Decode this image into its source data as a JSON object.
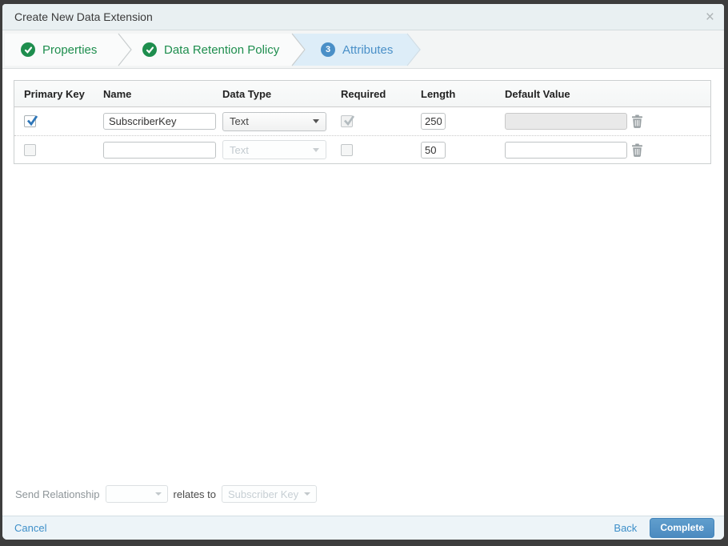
{
  "window": {
    "title": "Create New Data Extension",
    "close_icon": "×"
  },
  "wizard": {
    "steps": [
      {
        "label": "Properties",
        "status": "complete"
      },
      {
        "label": "Data Retention Policy",
        "status": "complete"
      },
      {
        "label": "Attributes",
        "status": "active",
        "number": "3"
      }
    ]
  },
  "table": {
    "headers": [
      "Primary Key",
      "Name",
      "Data Type",
      "Required",
      "Length",
      "Default Value"
    ],
    "rows": [
      {
        "primary_key": "checked",
        "name": "SubscriberKey",
        "data_type": "Text",
        "required": "checked-disabled",
        "length": "250",
        "default_value": "",
        "default_disabled": true
      },
      {
        "primary_key": "unchecked",
        "name": "",
        "data_type": "Text",
        "required": "unchecked",
        "length": "50",
        "default_value": "",
        "default_disabled": false
      }
    ]
  },
  "send_relationship": {
    "label": "Send Relationship",
    "source_value": "",
    "relates_to_label": "relates to",
    "target_value": "Subscriber Key"
  },
  "footer": {
    "cancel_label": "Cancel",
    "back_label": "Back",
    "complete_label": "Complete"
  },
  "colors": {
    "step_complete_green": "#1e8e4e",
    "step_active_blue": "#4a90c8",
    "step_active_bg": "#ddedf8",
    "link_blue": "#3d8fc9",
    "primary_button_blue": "#4b8ac0",
    "titlebar_bg": "#e9f0f2",
    "footer_bg": "#edf4f8",
    "checkbox_check_blue": "#2e76b8"
  }
}
